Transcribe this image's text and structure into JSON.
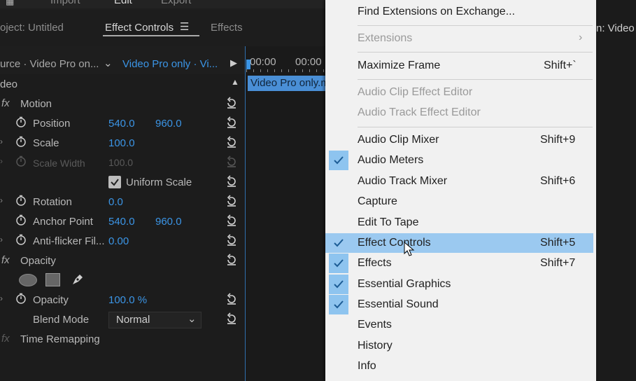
{
  "topbar": {
    "import": "Import",
    "edit": "Edit",
    "export": "Export"
  },
  "tabs": {
    "project": "oject: Untitled",
    "effect_controls": "Effect Controls",
    "effects": "Effects",
    "right": "n: Video"
  },
  "source": {
    "left": "urce · Video Pro on...",
    "right": "Video Pro only · Vi..."
  },
  "timeline": {
    "time1": "00:00",
    "time2": "00:00",
    "clip": "Video Pro only.m"
  },
  "effects": {
    "section": "deo",
    "motion": "Motion",
    "position": {
      "label": "Position",
      "x": "540.0",
      "y": "960.0"
    },
    "scale": {
      "label": "Scale",
      "value": "100.0"
    },
    "scale_width": {
      "label": "Scale Width",
      "value": "100.0"
    },
    "uniform_scale": "Uniform Scale",
    "rotation": {
      "label": "Rotation",
      "value": "0.0"
    },
    "anchor_point": {
      "label": "Anchor Point",
      "x": "540.0",
      "y": "960.0"
    },
    "anti_flicker": {
      "label": "Anti-flicker Fil...",
      "value": "0.00"
    },
    "opacity_section": "Opacity",
    "opacity": {
      "label": "Opacity",
      "value": "100.0 %"
    },
    "blend_mode": {
      "label": "Blend Mode",
      "value": "Normal"
    },
    "time_remapping": "Time Remapping",
    "fx": "fx"
  },
  "menu": {
    "items": [
      {
        "label": "Find Extensions on Exchange...",
        "shortcut": "",
        "checked": false,
        "disabled": false
      },
      {
        "label": "Extensions",
        "shortcut": "",
        "checked": false,
        "disabled": true,
        "submenu": true
      },
      {
        "label": "Maximize Frame",
        "shortcut": "Shift+`",
        "checked": false,
        "disabled": false
      },
      {
        "label": "Audio Clip Effect Editor",
        "shortcut": "",
        "checked": false,
        "disabled": true
      },
      {
        "label": "Audio Track Effect Editor",
        "shortcut": "",
        "checked": false,
        "disabled": true
      },
      {
        "label": "Audio Clip Mixer",
        "shortcut": "Shift+9",
        "checked": false,
        "disabled": false
      },
      {
        "label": "Audio Meters",
        "shortcut": "",
        "checked": true,
        "disabled": false
      },
      {
        "label": "Audio Track Mixer",
        "shortcut": "Shift+6",
        "checked": false,
        "disabled": false
      },
      {
        "label": "Capture",
        "shortcut": "",
        "checked": false,
        "disabled": false
      },
      {
        "label": "Edit To Tape",
        "shortcut": "",
        "checked": false,
        "disabled": false
      },
      {
        "label": "Effect Controls",
        "shortcut": "Shift+5",
        "checked": true,
        "disabled": false,
        "highlighted": true
      },
      {
        "label": "Effects",
        "shortcut": "Shift+7",
        "checked": true,
        "disabled": false
      },
      {
        "label": "Essential Graphics",
        "shortcut": "",
        "checked": true,
        "disabled": false
      },
      {
        "label": "Essential Sound",
        "shortcut": "",
        "checked": true,
        "disabled": false
      },
      {
        "label": "Events",
        "shortcut": "",
        "checked": false,
        "disabled": false
      },
      {
        "label": "History",
        "shortcut": "",
        "checked": false,
        "disabled": false
      },
      {
        "label": "Info",
        "shortcut": "",
        "checked": false,
        "disabled": false
      }
    ]
  },
  "colors": {
    "accent_blue": "#3b95e6",
    "menu_bg": "#f1f1f1",
    "menu_highlight": "#9bc9f0",
    "check_bg": "#8ec4ef"
  }
}
